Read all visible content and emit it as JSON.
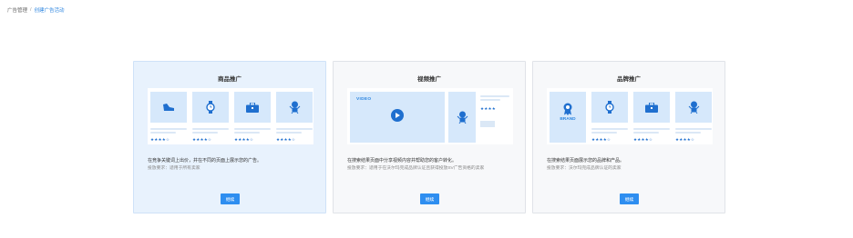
{
  "breadcrumb": {
    "parent": "广告管理",
    "separator": "/",
    "current": "创建广告活动"
  },
  "cards": [
    {
      "title": "商品推广",
      "stars": "★★★★☆",
      "description": "在竞争关键词上出价，并在不同的页面上展示您的广告。",
      "requirement": "投放要求：适用于所有卖家",
      "button": "继续"
    },
    {
      "title": "视频推广",
      "video_label": "VIDEO",
      "stars": "★★★★",
      "description": "在搜索结果页面中分享视频内容并帮助您的客户转化。",
      "requirement": "投放要求：适用于在沃尔玛完成品牌认证且获得投放SV广告资格的卖家",
      "button": "继续"
    },
    {
      "title": "品牌推广",
      "brand_label": "BRAND",
      "stars": "★★★★☆",
      "description": "在搜索结果页面展示您的品牌和产品。",
      "requirement": "投放要求：沃尔玛完成品牌认证的卖家",
      "button": "继续"
    }
  ],
  "colors": {
    "accent": "#2e8ef0",
    "tile": "#d6e8fb",
    "active_card": "#e8f2fd"
  },
  "icons": [
    "shoe-icon",
    "watch-icon",
    "briefcase-icon",
    "baby-icon",
    "play-icon",
    "ribbon-icon"
  ]
}
